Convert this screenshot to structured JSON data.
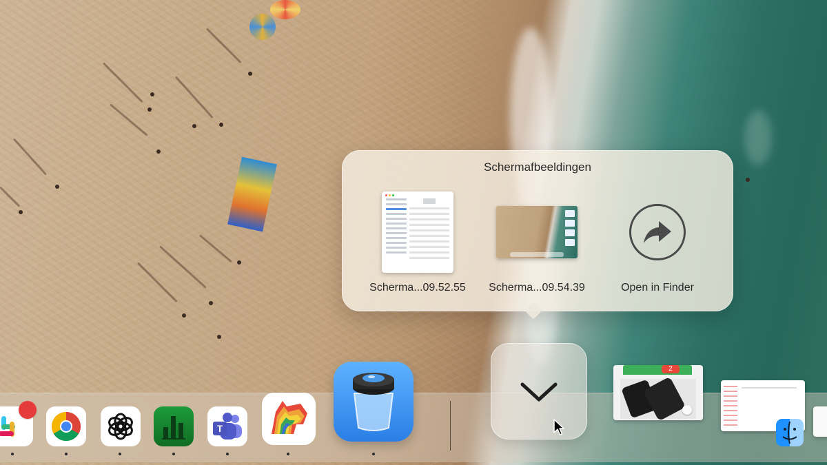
{
  "stack": {
    "title": "Schermafbeeldingen",
    "items": [
      {
        "label": "Scherma...09.52.55",
        "icon": "settings-screenshot-thumbnail"
      },
      {
        "label": "Scherma...09.54.39",
        "icon": "desktop-screenshot-thumbnail"
      },
      {
        "label": "Open in Finder",
        "icon": "arrow-forward-icon"
      }
    ]
  },
  "dock": {
    "apps": [
      {
        "name": "Slack",
        "icon": "slack-icon",
        "running": true,
        "badge": true
      },
      {
        "name": "Google Chrome",
        "icon": "chrome-icon",
        "running": true
      },
      {
        "name": "ChatGPT",
        "icon": "chatgpt-icon",
        "running": true
      },
      {
        "name": "Numbers",
        "icon": "numbers-icon",
        "running": true
      },
      {
        "name": "Microsoft Teams",
        "icon": "teams-icon",
        "running": true
      },
      {
        "name": "Bear",
        "icon": "bear-icon",
        "running": true
      },
      {
        "name": "Preview",
        "icon": "preview-icon",
        "running": true
      }
    ],
    "stack_tile_icon": "chevron-down-icon",
    "minimized": [
      {
        "icon": "minimized-window-notes",
        "badge_count": "2"
      },
      {
        "icon": "minimized-window-document"
      }
    ],
    "finder_icon": "finder-icon"
  },
  "colors": {
    "badge_red": "#e63b3b",
    "dock_bg": "#d7cdbe",
    "sea": "#2c6f63",
    "sand": "#c6a987"
  }
}
